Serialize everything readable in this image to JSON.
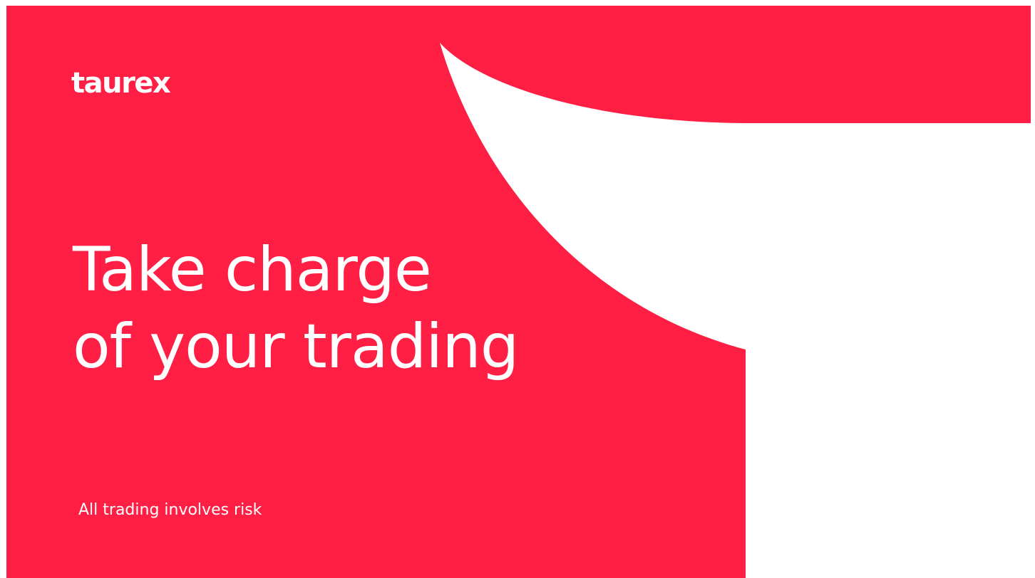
{
  "brand": {
    "logo_text": "taurex",
    "primary_color": "#ff1f45",
    "text_color": "#ffffff"
  },
  "headline": {
    "line1": "Take charge",
    "line2": "of your trading"
  },
  "disclaimer": "All trading involves risk"
}
